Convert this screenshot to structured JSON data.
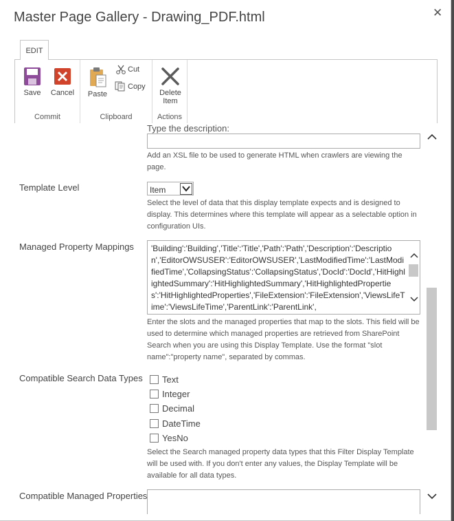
{
  "dialog": {
    "title": "Master Page Gallery - Drawing_PDF.html",
    "close": "✕"
  },
  "ribbon": {
    "tab": "EDIT",
    "groups": {
      "commit": {
        "label": "Commit",
        "save": "Save",
        "cancel": "Cancel"
      },
      "clipboard": {
        "label": "Clipboard",
        "paste": "Paste",
        "cut": "Cut",
        "copy": "Copy"
      },
      "actions": {
        "label": "Actions",
        "delete_line1": "Delete",
        "delete_line2": "Item"
      }
    }
  },
  "form": {
    "description": {
      "placeholder": "Type the description:",
      "help": "Add an XSL file to be used to generate HTML when crawlers are viewing the page."
    },
    "template_level": {
      "label": "Template Level",
      "value": "Item",
      "help": "Select the level of data that this display template expects and is designed to display.  This determines where this template will appear as a selectable option in configuration UIs."
    },
    "managed_property_mappings": {
      "label": "Managed Property Mappings",
      "value": "'Building':'Building','Title':'Title','Path':'Path','Description':'Description','EditorOWSUSER':'EditorOWSUSER','LastModifiedTime':'LastModifiedTime','CollapsingStatus':'CollapsingStatus','DocId':'DocId','HitHighlightedSummary':'HitHighlightedSummary','HitHighlightedProperties':'HitHighlightedProperties','FileExtension':'FileExtension','ViewsLifeTime':'ViewsLifeTime','ParentLink':'ParentLink',",
      "help": "Enter the slots and the managed properties that map to the slots. This field will be used to determine which managed properties are retrieved from SharePoint Search when you are using this Display Template. Use the format \"slot name\":\"property name\", separated by commas."
    },
    "compatible_search_data_types": {
      "label": "Compatible Search Data Types",
      "options": [
        "Text",
        "Integer",
        "Decimal",
        "DateTime",
        "YesNo"
      ],
      "help": "Select the Search managed property data types that this Filter Display Template will be used with. If you don't enter any values, the Display Template will be available for all data types."
    },
    "compatible_managed_properties": {
      "label": "Compatible Managed Properties"
    }
  }
}
